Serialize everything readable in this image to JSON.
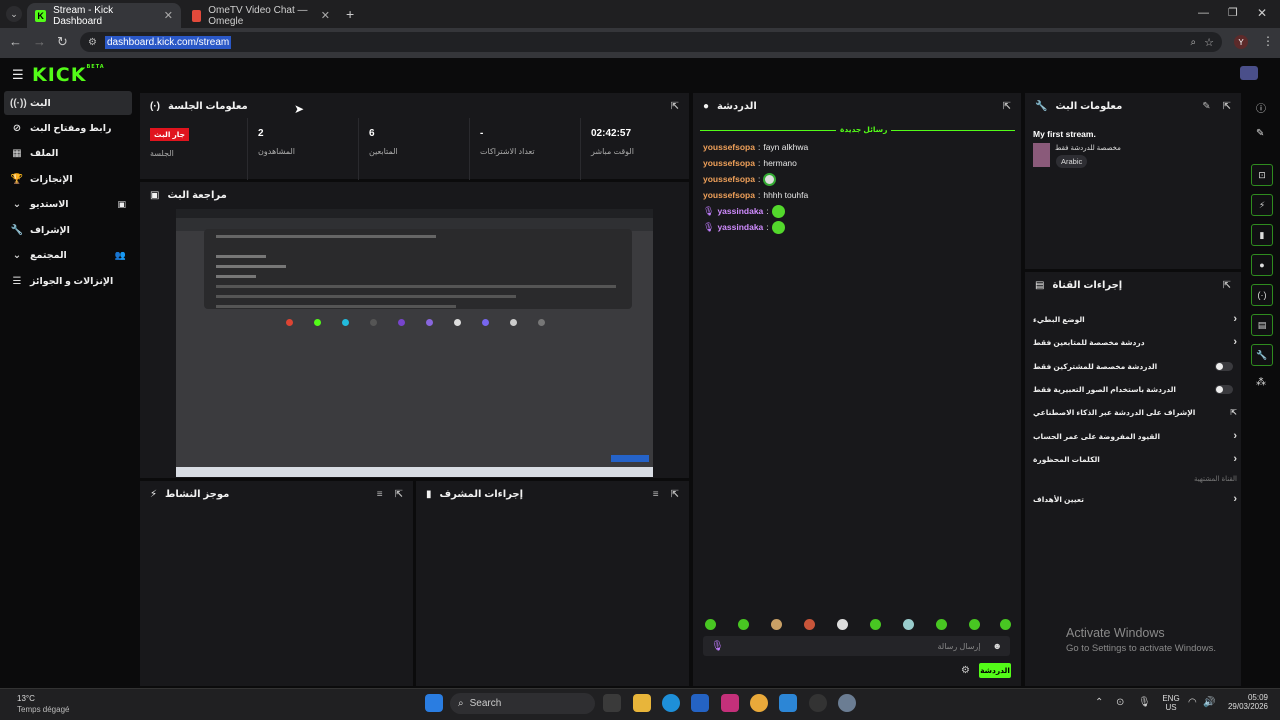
{
  "browser": {
    "tabs": [
      {
        "title": "Stream - Kick Dashboard"
      },
      {
        "title": "OmeTV Video Chat — Omegle"
      }
    ],
    "url": "dashboard.kick.com/stream",
    "profile_initial": "Y"
  },
  "sidebar": {
    "items": [
      {
        "label": "البث",
        "icon": "broadcast-icon"
      },
      {
        "label": "رابط ومفتاح البث",
        "icon": "link-icon"
      },
      {
        "label": "الملف",
        "icon": "profile-icon"
      },
      {
        "label": "الإنجازات",
        "icon": "trophy-icon"
      },
      {
        "label": "الاستديو",
        "icon": "studio-icon"
      },
      {
        "label": "الإشراف",
        "icon": "wrench-icon"
      },
      {
        "label": "المجتمع",
        "icon": "community-icon"
      },
      {
        "label": "الإنزالات و الجوائز",
        "icon": "drops-icon"
      }
    ]
  },
  "session": {
    "title": "معلومات الجلسة",
    "live_badge": "جار البث",
    "session_label": "الجلسة",
    "viewers_value": "2",
    "viewers_label": "المشاهدون",
    "followers_value": "6",
    "followers_label": "المتابعين",
    "subs_value": "-",
    "subs_label": "تعداد الاشتراكات",
    "uptime_value": "02:42:57",
    "uptime_label": "الوقت مباشر"
  },
  "preview": {
    "title": "مراجعة البث"
  },
  "activity": {
    "title": "موجز النشاط"
  },
  "modactions": {
    "title": "إجراءات المشرف"
  },
  "chat": {
    "title": "الدردشة",
    "new_messages": "رسائل جديدة",
    "messages": [
      {
        "user": "youssefsopa",
        "text": "fayn alkhwa"
      },
      {
        "user": "youssefsopa",
        "text": "hermano"
      },
      {
        "user": "youssefsopa",
        "text": ""
      },
      {
        "user": "youssefsopa",
        "text": "hhhh touhfa"
      },
      {
        "user": "yassindaka",
        "text": ""
      },
      {
        "user": "yassindaka",
        "text": ""
      }
    ],
    "input_placeholder": "إرسال رسالة",
    "send_label": "الدردشة"
  },
  "streaminfo": {
    "title": "معلومات البث",
    "stream_title": "My first stream.",
    "category": "مخصصة للدردشة فقط",
    "language": "Arabic"
  },
  "channel_actions": {
    "title": "إجراءات القناة",
    "rows": [
      {
        "label": "الوضع البطيء",
        "control": "chevron"
      },
      {
        "label": "دردشة مخصصة للمتابعين فقط",
        "control": "chevron"
      },
      {
        "label": "الدردشة مخصصة للمشتركين فقط",
        "control": "toggle"
      },
      {
        "label": "الدردشة باستخدام الصور التعبيرية فقط",
        "control": "toggle"
      },
      {
        "label": "الإشراف على الدردشة عبر الذكاء الاصطناعي",
        "control": "external"
      },
      {
        "label": "القيود المفروضة على عمر الحساب",
        "control": "chevron"
      },
      {
        "label": "الكلمات المحظورة",
        "control": "chevron"
      }
    ],
    "section_label": "القناة المشتهية",
    "targets_label": "تعيين الأهداف"
  },
  "watermark": {
    "line1": "Activate Windows",
    "line2": "Go to Settings to activate Windows."
  },
  "taskbar": {
    "weather_temp": "13°C",
    "weather_desc": "Temps dégagé",
    "search_placeholder": "Search",
    "lang": "ENG",
    "region": "US",
    "time": "05:09",
    "date": "29/03/2026"
  },
  "colors": {
    "accent": "#53fc18",
    "live": "#e0141e"
  }
}
